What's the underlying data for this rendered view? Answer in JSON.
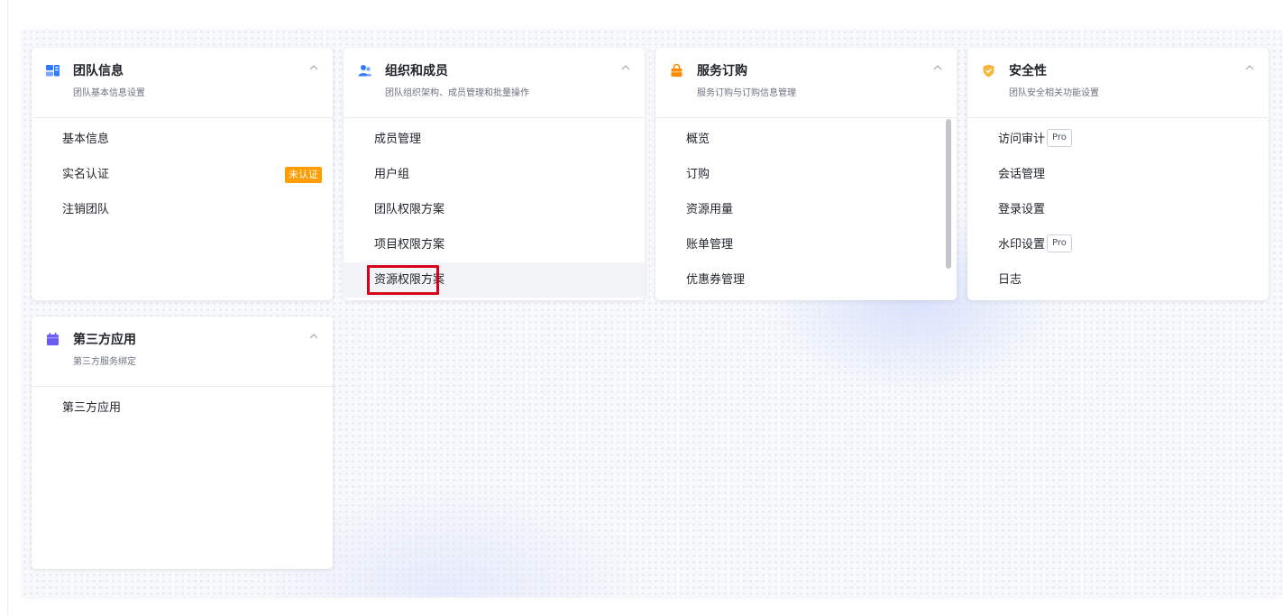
{
  "cards": [
    {
      "title": "团队信息",
      "subtitle": "团队基本信息设置",
      "icon": "team-info-icon",
      "icon_color": "#2f7bff",
      "items": [
        {
          "label": "基本信息"
        },
        {
          "label": "实名认证",
          "badge": "未认证"
        },
        {
          "label": "注销团队"
        }
      ]
    },
    {
      "title": "组织和成员",
      "subtitle": "团队组织架构、成员管理和批量操作",
      "icon": "members-icon",
      "icon_color": "#2f7bff",
      "items": [
        {
          "label": "成员管理"
        },
        {
          "label": "用户组"
        },
        {
          "label": "团队权限方案"
        },
        {
          "label": "项目权限方案"
        },
        {
          "label": "资源权限方案"
        }
      ]
    },
    {
      "title": "服务订购",
      "subtitle": "服务订购与订购信息管理",
      "icon": "shopping-bag-icon",
      "icon_color": "#ff8a00",
      "items": [
        {
          "label": "概览"
        },
        {
          "label": "订购"
        },
        {
          "label": "资源用量"
        },
        {
          "label": "账单管理"
        },
        {
          "label": "优惠券管理"
        }
      ]
    },
    {
      "title": "安全性",
      "subtitle": "团队安全相关功能设置",
      "icon": "shield-icon",
      "icon_color": "#f5b83d",
      "items": [
        {
          "label": "访问审计",
          "tag": "Pro"
        },
        {
          "label": "会话管理"
        },
        {
          "label": "登录设置"
        },
        {
          "label": "水印设置",
          "tag": "Pro"
        },
        {
          "label": "日志"
        }
      ]
    },
    {
      "title": "第三方应用",
      "subtitle": "第三方服务绑定",
      "icon": "calendar-app-icon",
      "icon_color": "#6b5cf6",
      "items": [
        {
          "label": "第三方应用"
        }
      ]
    }
  ],
  "colors": {
    "badge_bg": "#ff9d00",
    "highlight_border": "#d6001c"
  }
}
